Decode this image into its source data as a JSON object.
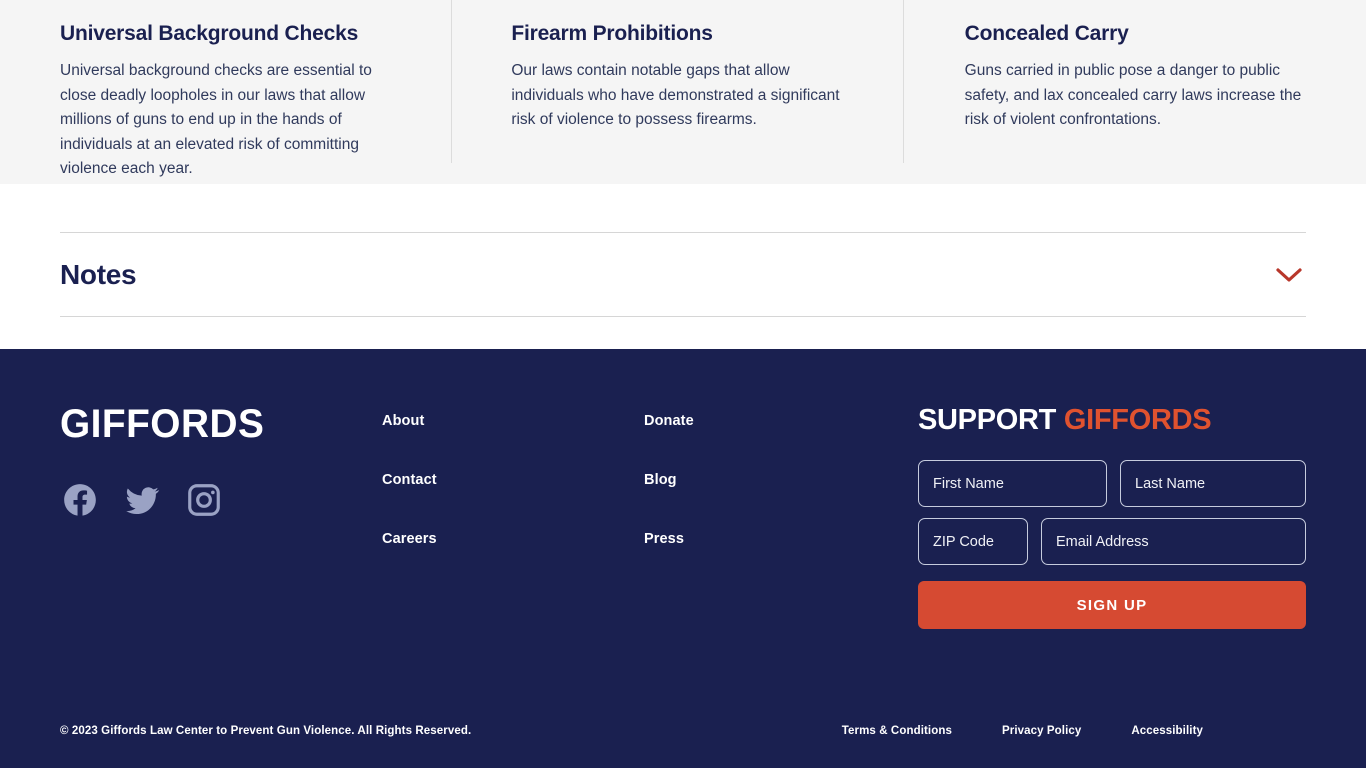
{
  "issues": {
    "columns": [
      {
        "title": "Universal Background Checks",
        "description": "Universal background checks are essential to close deadly loopholes in our laws that allow millions of guns to end up in the hands of individuals at an elevated risk of committing violence each year."
      },
      {
        "title": "Firearm Prohibitions",
        "description": "Our laws contain notable gaps that allow individuals who have demonstrated a significant risk of violence to possess firearms."
      },
      {
        "title": "Concealed Carry",
        "description": "Guns carried in public pose a danger to public safety, and lax concealed carry laws increase the risk of violent confrontations."
      }
    ]
  },
  "notes": {
    "title": "Notes",
    "toggle_icon": "chevron-down-icon",
    "expanded": false
  },
  "footer": {
    "brand": "GIFFORDS",
    "social": [
      {
        "name": "facebook-icon",
        "label": "Facebook"
      },
      {
        "name": "twitter-icon",
        "label": "Twitter"
      },
      {
        "name": "instagram-icon",
        "label": "Instagram"
      }
    ],
    "nav_col_1": [
      {
        "label": "About"
      },
      {
        "label": "Contact"
      },
      {
        "label": "Careers"
      }
    ],
    "nav_col_2": [
      {
        "label": "Donate"
      },
      {
        "label": "Blog"
      },
      {
        "label": "Press"
      }
    ],
    "signup": {
      "heading_primary": "SUPPORT",
      "heading_accent": "GIFFORDS",
      "first_name_placeholder": "First Name",
      "first_name_value": "",
      "last_name_placeholder": "Last Name",
      "last_name_value": "",
      "zip_placeholder": "ZIP Code",
      "zip_value": "",
      "email_placeholder": "Email Address",
      "email_value": "",
      "submit_label": "SIGN UP"
    },
    "copyright": "© 2023 Giffords Law Center to Prevent Gun Violence. All Rights Reserved.",
    "legal": [
      {
        "label": "Terms & Conditions"
      },
      {
        "label": "Privacy Policy"
      },
      {
        "label": "Accessibility"
      }
    ]
  },
  "colors": {
    "navy": "#1a2050",
    "accent_orange": "#d64a32",
    "heading_accent": "#e0522f",
    "band_gray": "#f5f5f5",
    "chevron_red": "#b8372b",
    "social_icon": "#9aa2c4"
  }
}
